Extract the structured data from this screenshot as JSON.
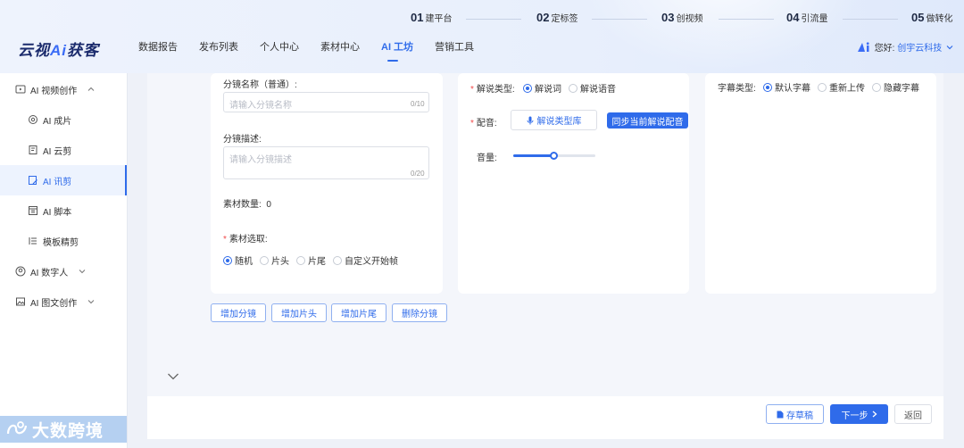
{
  "steps": [
    {
      "num": "01",
      "label": "建平台"
    },
    {
      "num": "02",
      "label": "定标签"
    },
    {
      "num": "03",
      "label": "创视频"
    },
    {
      "num": "04",
      "label": "引流量"
    },
    {
      "num": "05",
      "label": "做转化"
    }
  ],
  "logo": {
    "prefix": "云视",
    "ai": "Ai",
    "suffix": "获客"
  },
  "nav": [
    "数据报告",
    "发布列表",
    "个人中心",
    "素材中心",
    "AI 工坊",
    "营销工具"
  ],
  "user": {
    "greeting": "您好:",
    "company": "创宇云科技"
  },
  "sidebar": {
    "items": [
      {
        "label": "AI 视频创作",
        "icon": "video-icon"
      },
      {
        "label": "AI 成片",
        "icon": "at-icon"
      },
      {
        "label": "AI 云剪",
        "icon": "clip-icon"
      },
      {
        "label": "AI 讯剪",
        "icon": "edit-doc-icon"
      },
      {
        "label": "AI 脚本",
        "icon": "script-icon"
      },
      {
        "label": "模板精剪",
        "icon": "template-icon"
      },
      {
        "label": "AI 数字人",
        "icon": "avatar-icon"
      },
      {
        "label": "AI 图文创作",
        "icon": "image-icon"
      }
    ]
  },
  "watermark": "大数跨境",
  "card1": {
    "name_label": "分镜名称（普通）:",
    "name_placeholder": "请输入分镜名称",
    "name_counter": "0/10",
    "desc_label": "分镜描述:",
    "desc_placeholder": "请输入分镜描述",
    "desc_counter": "0/20",
    "count_label": "素材数量:",
    "count_value": "0",
    "select_label": "素材选取:",
    "select_options": [
      "随机",
      "片头",
      "片尾",
      "自定义开始帧"
    ]
  },
  "card2": {
    "narration_label": "解说类型:",
    "narration_options": [
      "解说词",
      "解说语音"
    ],
    "dub_label": "配音:",
    "dub_lib_button": "解说类型库",
    "dub_sync_button": "同步当前解说配音",
    "volume_label": "音量:",
    "volume_level": 0.5
  },
  "card3": {
    "subtitle_label": "字幕类型:",
    "subtitle_options": [
      "默认字幕",
      "重新上传",
      "隐藏字幕"
    ]
  },
  "actions": [
    "增加分镜",
    "增加片头",
    "增加片尾",
    "删除分镜"
  ],
  "footer": {
    "save": "存草稿",
    "next": "下一步",
    "back": "返回"
  },
  "colors": {
    "accent": "#2f6bea",
    "required": "#f04b4b"
  }
}
